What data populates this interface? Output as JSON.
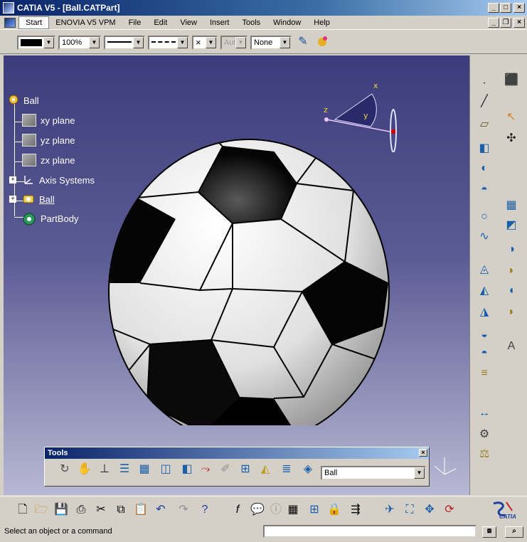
{
  "window": {
    "title": "CATIA V5 - [Ball.CATPart]"
  },
  "menu": {
    "items": [
      "Start",
      "ENOVIA V5 VPM",
      "File",
      "Edit",
      "View",
      "Insert",
      "Tools",
      "Window",
      "Help"
    ]
  },
  "toolbar": {
    "zoom": "100%",
    "auto_label": "Aut",
    "layer": "None"
  },
  "tree": {
    "root": "Ball",
    "planes": [
      "xy plane",
      "yz plane",
      "zx plane"
    ],
    "axis_systems": "Axis Systems",
    "geo_set": "Ball",
    "part_body": "PartBody"
  },
  "compass": {
    "x_label": "x",
    "y_label": "y",
    "z_label": "z"
  },
  "tools_panel": {
    "title": "Tools",
    "current_set": "Ball"
  },
  "status": {
    "message": "Select an object or a command"
  },
  "brand": {
    "logo_text": "CATIA"
  },
  "colors": {
    "title_bar": "#0a246a",
    "viewport_top": "#3c3c7c",
    "viewport_bottom": "#b8b8d4",
    "tree_text": "#ffffff",
    "compass": "#2a2a6a"
  }
}
